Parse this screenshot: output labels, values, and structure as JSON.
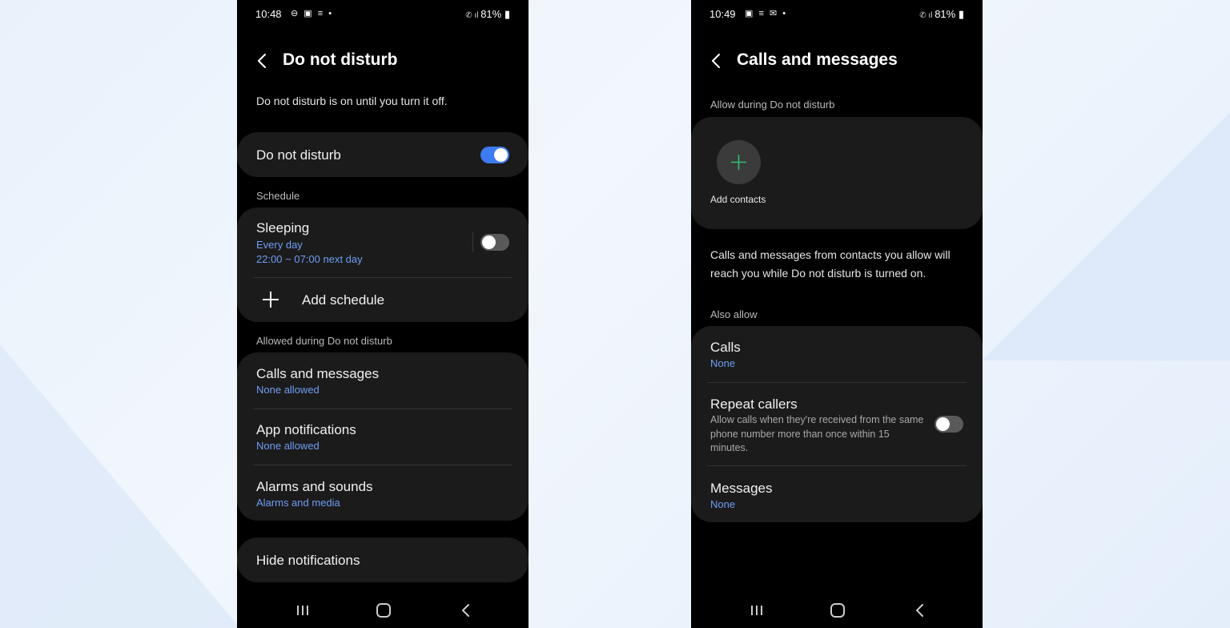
{
  "left": {
    "status": {
      "time": "10:48",
      "icons": "⊖ ▣ ≡ •",
      "right": "81%"
    },
    "title": "Do not disturb",
    "description": "Do not disturb is on until you turn it off.",
    "dnd_label": "Do not disturb",
    "dnd_on": true,
    "schedule_header": "Schedule",
    "sleeping": {
      "title": "Sleeping",
      "days": "Every day",
      "time": "22:00 ~ 07:00 next day",
      "on": false
    },
    "add_schedule": "Add schedule",
    "allowed_header": "Allowed during Do not disturb",
    "allowed_items": [
      {
        "title": "Calls and messages",
        "sub": "None allowed"
      },
      {
        "title": "App notifications",
        "sub": "None allowed"
      },
      {
        "title": "Alarms and sounds",
        "sub": "Alarms and media"
      }
    ],
    "hide_notifications": "Hide notifications"
  },
  "right": {
    "status": {
      "time": "10:49",
      "icons": "▣ ≡ ✉ •",
      "right": "81%"
    },
    "title": "Calls and messages",
    "allow_header": "Allow during Do not disturb",
    "add_contacts": "Add contacts",
    "info": "Calls and messages from contacts you allow will reach you while Do not disturb is turned on.",
    "also_allow": "Also allow",
    "calls": {
      "title": "Calls",
      "sub": "None"
    },
    "repeat": {
      "title": "Repeat callers",
      "desc": "Allow calls when they're received from the same phone number more than once within 15 minutes.",
      "on": false
    },
    "messages": {
      "title": "Messages",
      "sub": "None"
    }
  },
  "colors": {
    "accent_blue": "#3e7bf0",
    "link_blue": "#6f9df5",
    "card": "#1b1b1b",
    "plus_green": "#2fbf71"
  }
}
